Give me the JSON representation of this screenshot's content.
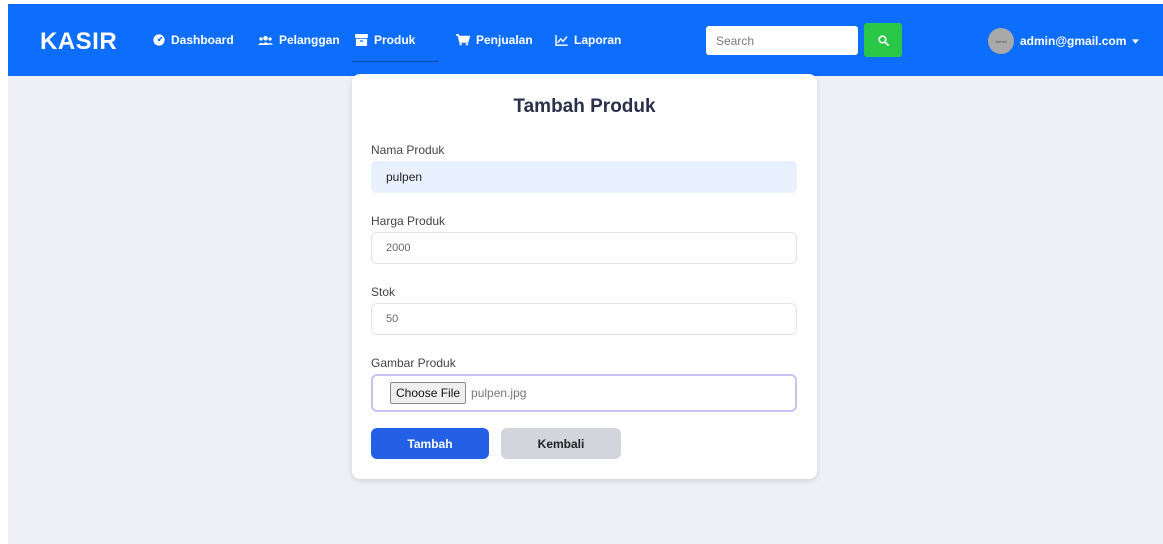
{
  "brand": "KASIR",
  "nav": {
    "items": [
      {
        "label": "Dashboard",
        "icon": "tachometer-icon"
      },
      {
        "label": "Pelanggan",
        "icon": "users-icon"
      },
      {
        "label": "Produk",
        "icon": "box-icon",
        "active": true
      },
      {
        "label": "Penjualan",
        "icon": "cart-icon"
      },
      {
        "label": "Laporan",
        "icon": "chart-line-icon"
      }
    ]
  },
  "search": {
    "placeholder": "Search",
    "value": "",
    "button_icon": "search-icon"
  },
  "user": {
    "email": "admin@gmail.com",
    "avatar_text": "Admin"
  },
  "form": {
    "title": "Tambah Produk",
    "nama_label": "Nama Produk",
    "nama_value": "pulpen",
    "harga_label": "Harga Produk",
    "harga_value": "2000",
    "stok_label": "Stok",
    "stok_value": "50",
    "gambar_label": "Gambar Produk",
    "file_button": "Choose File",
    "file_name": "pulpen.jpg",
    "submit_label": "Tambah",
    "back_label": "Kembali"
  },
  "colors": {
    "navbar": "#0d6efd",
    "search_button": "#28c745",
    "primary_button": "#2360e6",
    "secondary_button": "#d2d5db",
    "page_background": "#eef0f5"
  }
}
